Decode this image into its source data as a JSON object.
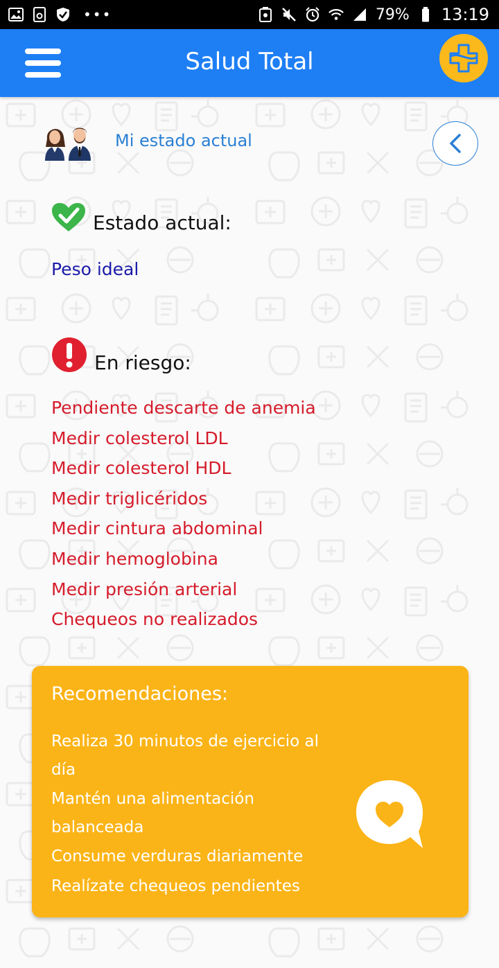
{
  "status_bar": {
    "battery": "79%",
    "time": "13:19"
  },
  "app_bar": {
    "title": "Salud Total"
  },
  "profile": {
    "label": "Mi estado actual"
  },
  "status": {
    "heading": "Estado actual:",
    "items": [
      "Peso ideal"
    ]
  },
  "risk": {
    "heading": "En riesgo:",
    "items": [
      "Pendiente descarte de anemia",
      "Medir colesterol LDL",
      "Medir colesterol HDL",
      "Medir triglicéridos",
      "Medir cintura abdominal",
      "Medir hemoglobina",
      "Medir presión arterial",
      "Chequeos no realizados"
    ]
  },
  "recommendations": {
    "title": "Recomendaciones:",
    "items": [
      "Realiza 30 minutos de ejercicio al día",
      "Mantén una alimentación balanceada",
      "Consume verduras diariamente",
      "Realízate chequeos pendientes"
    ]
  },
  "colors": {
    "app_bar": "#1e7ff5",
    "accent": "#fbb91c",
    "ok": "#3cb54a",
    "risk": "#d51b2a",
    "link": "#2a7fd4"
  },
  "icons": {
    "menu": "hamburger-icon",
    "logo": "medical-cross-logo-icon",
    "back": "chevron-left-icon",
    "ok": "heart-check-icon",
    "risk": "alert-circle-icon",
    "recommendations": "heart-chat-bubble-icon"
  }
}
